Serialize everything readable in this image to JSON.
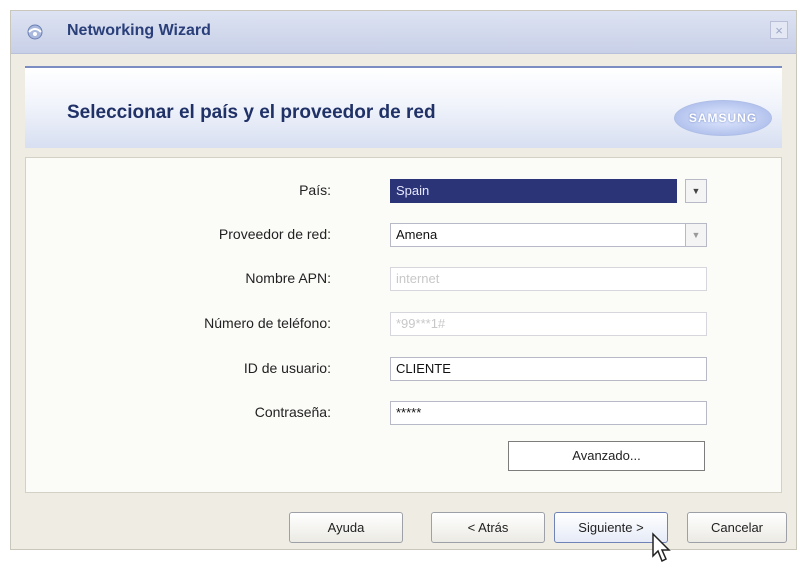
{
  "window": {
    "title": "Networking Wizard",
    "close_glyph": "×"
  },
  "banner": {
    "title": "Seleccionar el país y el proveedor de red",
    "logo_text": "SAMSUNG"
  },
  "form": {
    "country": {
      "label": "País:",
      "value": "Spain"
    },
    "provider": {
      "label": "Proveedor de red:",
      "value": "Amena"
    },
    "apn": {
      "label": "Nombre APN:",
      "value": "internet"
    },
    "phone": {
      "label": "Número de teléfono:",
      "value": "*99***1#"
    },
    "user": {
      "label": "ID de usuario:",
      "value": "CLIENTE"
    },
    "password": {
      "label": "Contraseña:",
      "value": "*****"
    },
    "advanced_label": "Avanzado..."
  },
  "buttons": {
    "help": "Ayuda",
    "back": "< Atrás",
    "next": "Siguiente >",
    "cancel": "Cancelar"
  },
  "icons": {
    "app": "wizard-app-icon",
    "dropdown": "chevron-down-icon",
    "cursor": "mouse-pointer-icon"
  },
  "colors": {
    "title_text": "#2a3f7a",
    "selection": "#2b3476",
    "accent": "#7b8cc2"
  }
}
